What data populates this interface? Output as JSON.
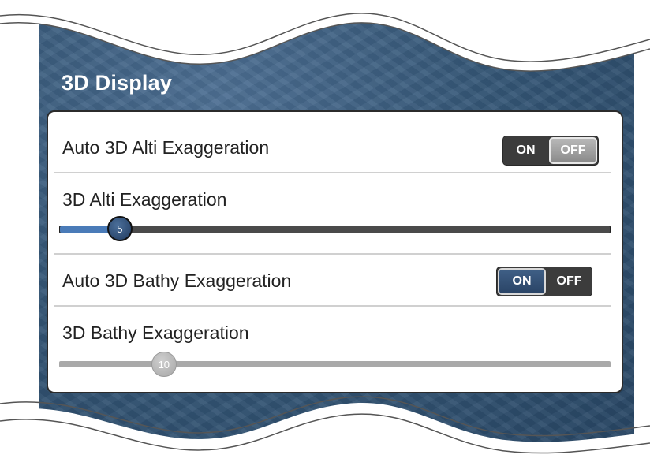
{
  "page": {
    "title": "3D Display"
  },
  "settings": {
    "auto_alti": {
      "label": "Auto 3D Alti Exaggeration",
      "on_label": "ON",
      "off_label": "OFF",
      "selected": "OFF"
    },
    "alti": {
      "label": "3D Alti Exaggeration",
      "value": "5",
      "fraction": 0.11
    },
    "auto_bathy": {
      "label": "Auto 3D Bathy Exaggeration",
      "on_label": "ON",
      "off_label": "OFF",
      "selected": "ON"
    },
    "bathy": {
      "label": "3D Bathy Exaggeration",
      "value": "10",
      "fraction": 0.19
    }
  },
  "colors": {
    "accent": "#2a4466",
    "slider_fill": "#4a7bb8",
    "disabled": "#a9a9a9"
  }
}
